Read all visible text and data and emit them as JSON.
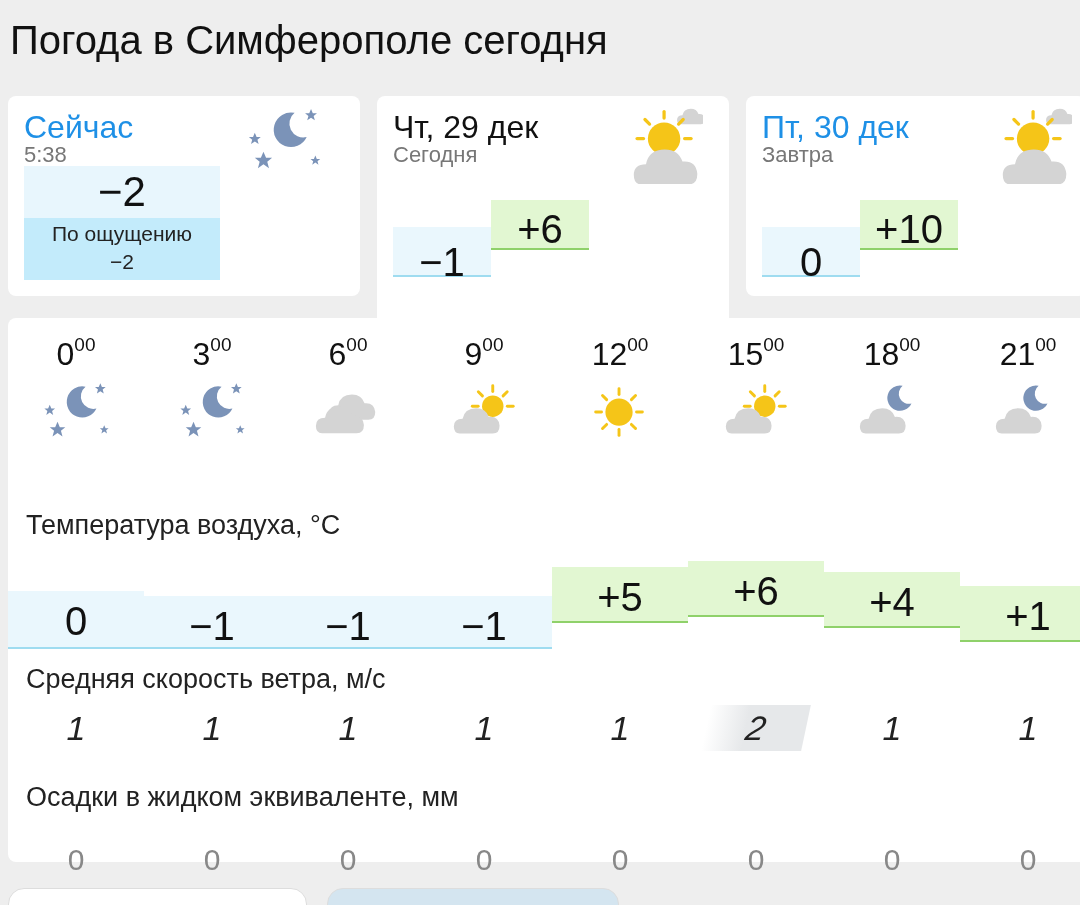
{
  "title": "Погода в Симферополе сегодня",
  "now": {
    "label": "Сейчас",
    "time": "5:38",
    "temp": "−2",
    "feels_label": "По ощущению",
    "feels": "−2"
  },
  "days": [
    {
      "name": "Чт, 29 дек",
      "sub": "Сегодня",
      "selected": true,
      "temps": [
        {
          "value": "−1",
          "color": "#eaf7fd"
        },
        {
          "value": "+6",
          "color": "#e2f7d2"
        }
      ]
    },
    {
      "name": "Пт, 30 дек",
      "sub": "Завтра",
      "selected": false,
      "temps": [
        {
          "value": "0",
          "color": "#eaf7fd"
        },
        {
          "value": "+10",
          "color": "#e2f7d2"
        }
      ]
    }
  ],
  "hours": [
    {
      "time": "0$^{00}$",
      "kind": "night-clear",
      "temp": "0",
      "color": "#eaf7fd",
      "wind": "1",
      "wind_highlight": false,
      "precip": "0"
    },
    {
      "time": "3$^{00}$",
      "kind": "night-clear",
      "temp": "−1",
      "color": "#eaf7fd",
      "wind": "1",
      "wind_highlight": false,
      "precip": "0"
    },
    {
      "time": "6$^{00}$",
      "kind": "cloudy",
      "temp": "−1",
      "color": "#eaf7fd",
      "wind": "1",
      "wind_highlight": false,
      "precip": "0"
    },
    {
      "time": "9$^{00}$",
      "kind": "partly-sunny",
      "temp": "−1",
      "color": "#eaf7fd",
      "wind": "1",
      "wind_highlight": false,
      "precip": "0"
    },
    {
      "time": "12$^{00}$",
      "kind": "sunny",
      "temp": "+5",
      "color": "#e2f7d2",
      "wind": "1",
      "wind_highlight": false,
      "precip": "0"
    },
    {
      "time": "15$^{00}$",
      "kind": "partly-sunny",
      "temp": "+6",
      "color": "#e2f7d2",
      "wind": "2",
      "wind_highlight": true,
      "precip": "0"
    },
    {
      "time": "18$^{00}$",
      "kind": "partly-night",
      "temp": "+4",
      "color": "#e2f7d2",
      "wind": "1",
      "wind_highlight": false,
      "precip": "0"
    },
    {
      "time": "21$^{00}$",
      "kind": "partly-night",
      "temp": "+1",
      "color": "#e2f7d2",
      "wind": "1",
      "wind_highlight": false,
      "precip": "0"
    }
  ],
  "labels": {
    "temperature": "Температура воздуха, °C",
    "wind": "Средняя скорость ветра, м/с",
    "precip": "Осадки в жидком эквиваленте, мм"
  },
  "bottom_buttons": [
    {
      "kind": "plain"
    },
    {
      "kind": "accent"
    }
  ]
}
